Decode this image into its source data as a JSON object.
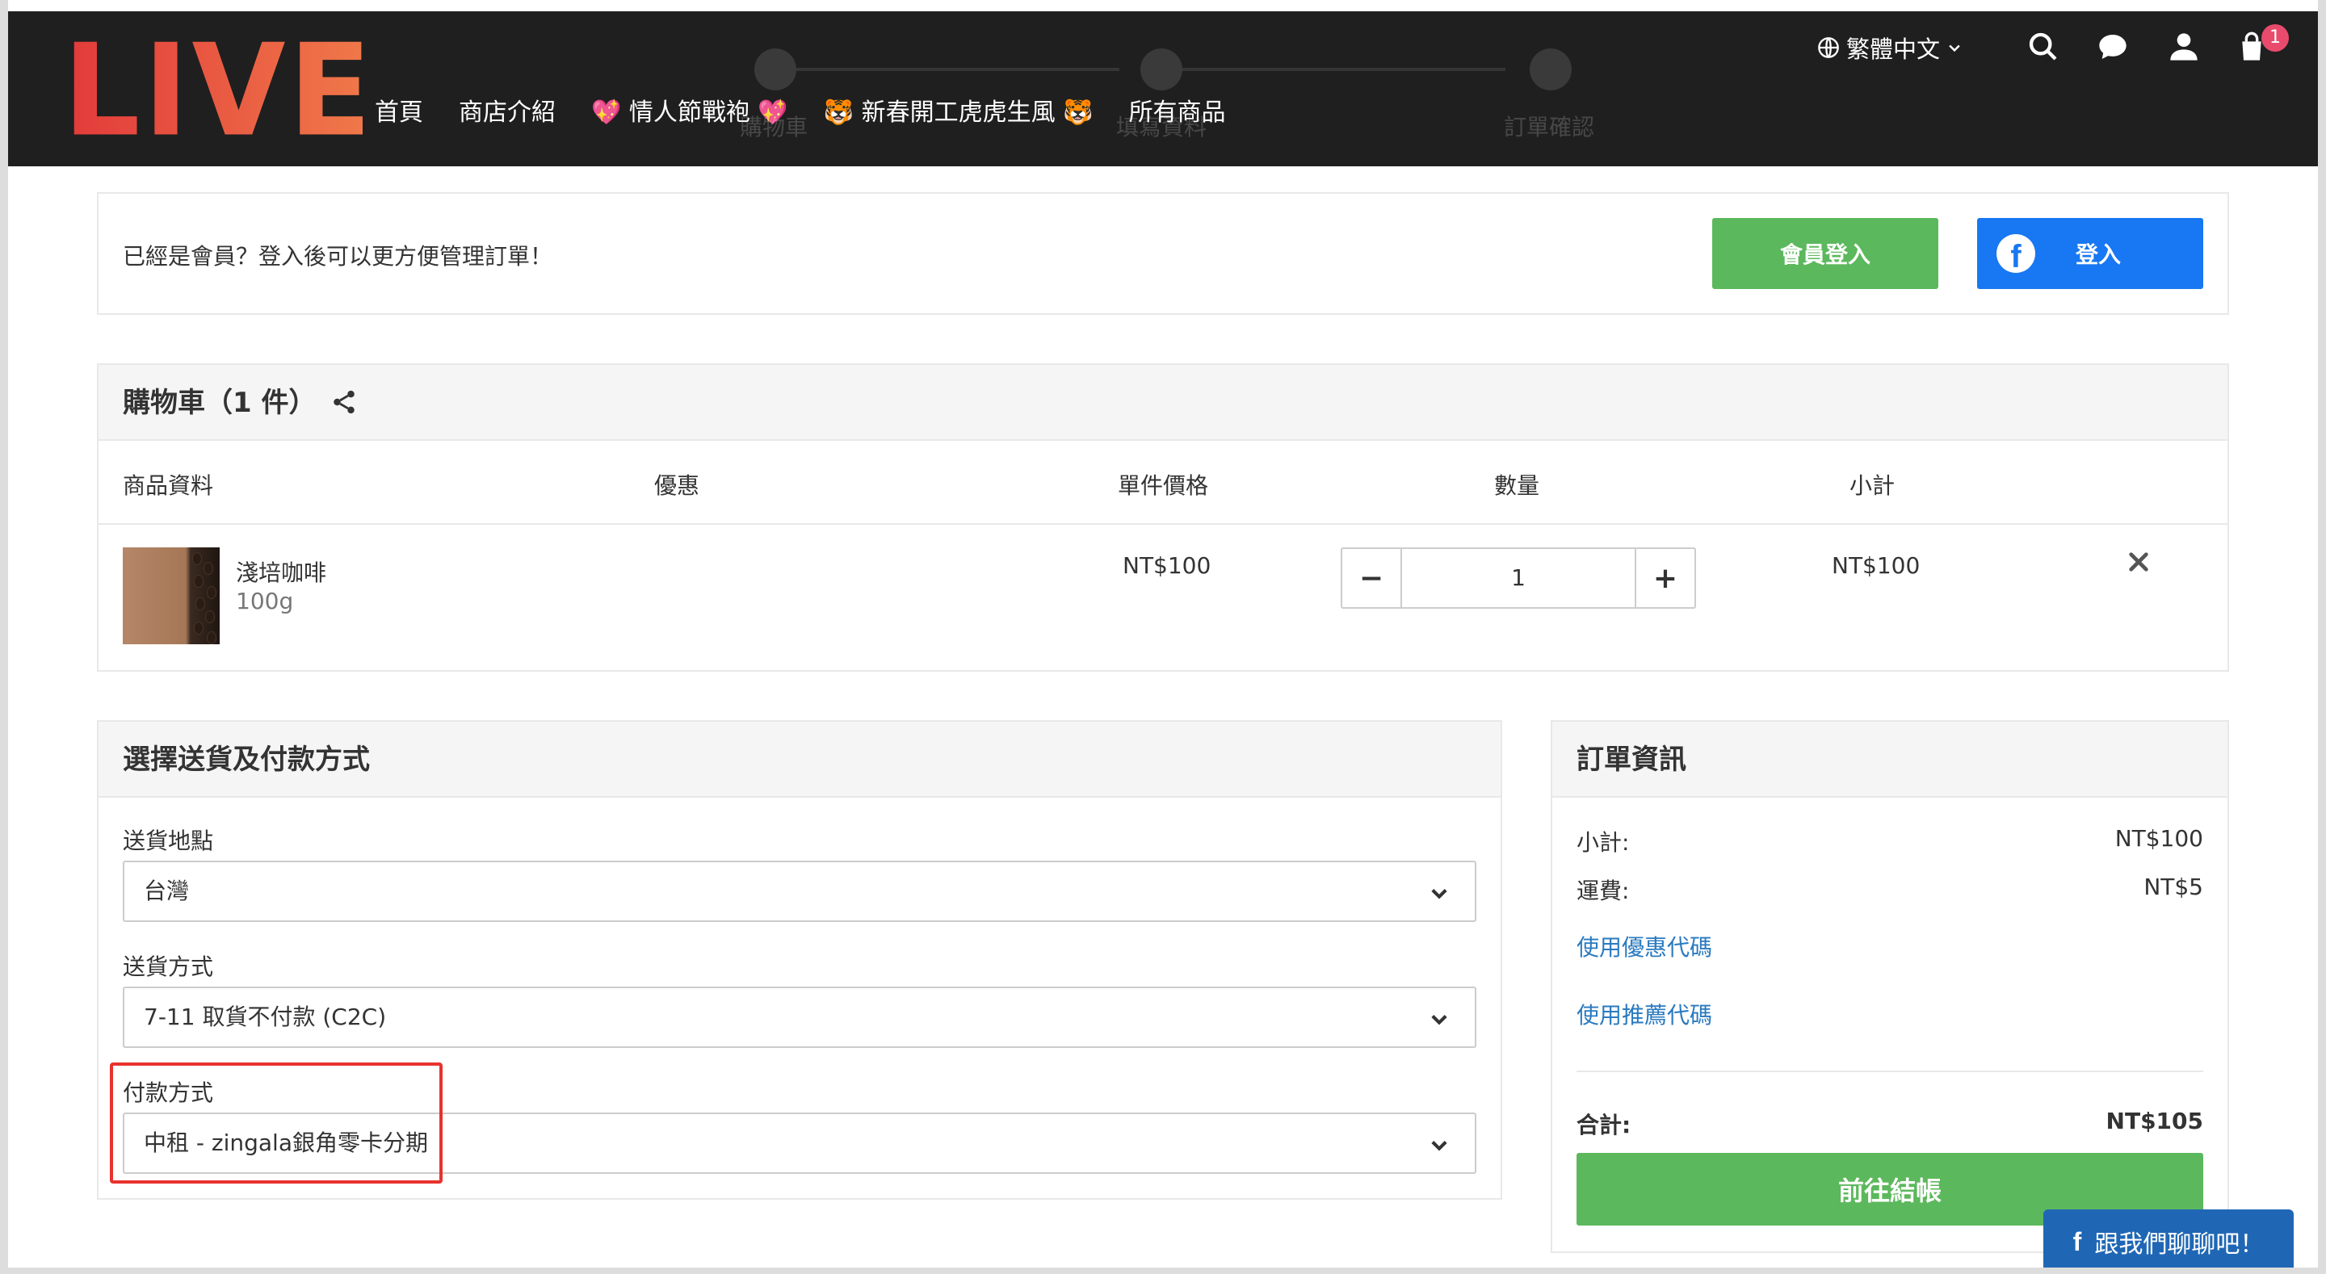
{
  "header": {
    "logo": "LIVE",
    "nav": [
      "首頁",
      "商店介紹",
      "💖 情人節戰袍 💖",
      "🐯 新春開工虎虎生風 🐯",
      "所有商品"
    ],
    "language": "繁體中文",
    "cart_count": "1"
  },
  "steps": [
    "購物車",
    "填寫資料",
    "訂單確認"
  ],
  "login": {
    "prompt": "已經是會員？登入後可以更方便管理訂單！",
    "member_button": "會員登入",
    "fb_button": "登入"
  },
  "cart": {
    "title": "購物車（1 件）",
    "columns": [
      "商品資料",
      "優惠",
      "單件價格",
      "數量",
      "小計"
    ],
    "items": [
      {
        "name": "淺培咖啡",
        "variant": "100g",
        "price": "NT$100",
        "quantity": "1",
        "subtotal": "NT$100"
      }
    ]
  },
  "delivery": {
    "title": "選擇送貨及付款方式",
    "location_label": "送貨地點",
    "location_value": "台灣",
    "method_label": "送貨方式",
    "method_value": "7-11 取貨不付款 (C2C)",
    "payment_label": "付款方式",
    "payment_value": "中租 - zingala銀角零卡分期"
  },
  "order": {
    "title": "訂單資訊",
    "subtotal_label": "小計:",
    "subtotal_value": "NT$100",
    "shipping_label": "運費:",
    "shipping_value": "NT$5",
    "coupon_link": "使用優惠代碼",
    "referral_link": "使用推薦代碼",
    "total_label": "合計:",
    "total_value": "NT$105",
    "checkout_button": "前往結帳"
  },
  "chat": {
    "label": "跟我們聊聊吧！"
  },
  "colors": {
    "accent_green": "#5cb85c",
    "facebook_blue": "#1877f2",
    "logo_red": "#e8493f",
    "highlight_red": "#e8322e",
    "link_blue": "#2a7ac0"
  }
}
